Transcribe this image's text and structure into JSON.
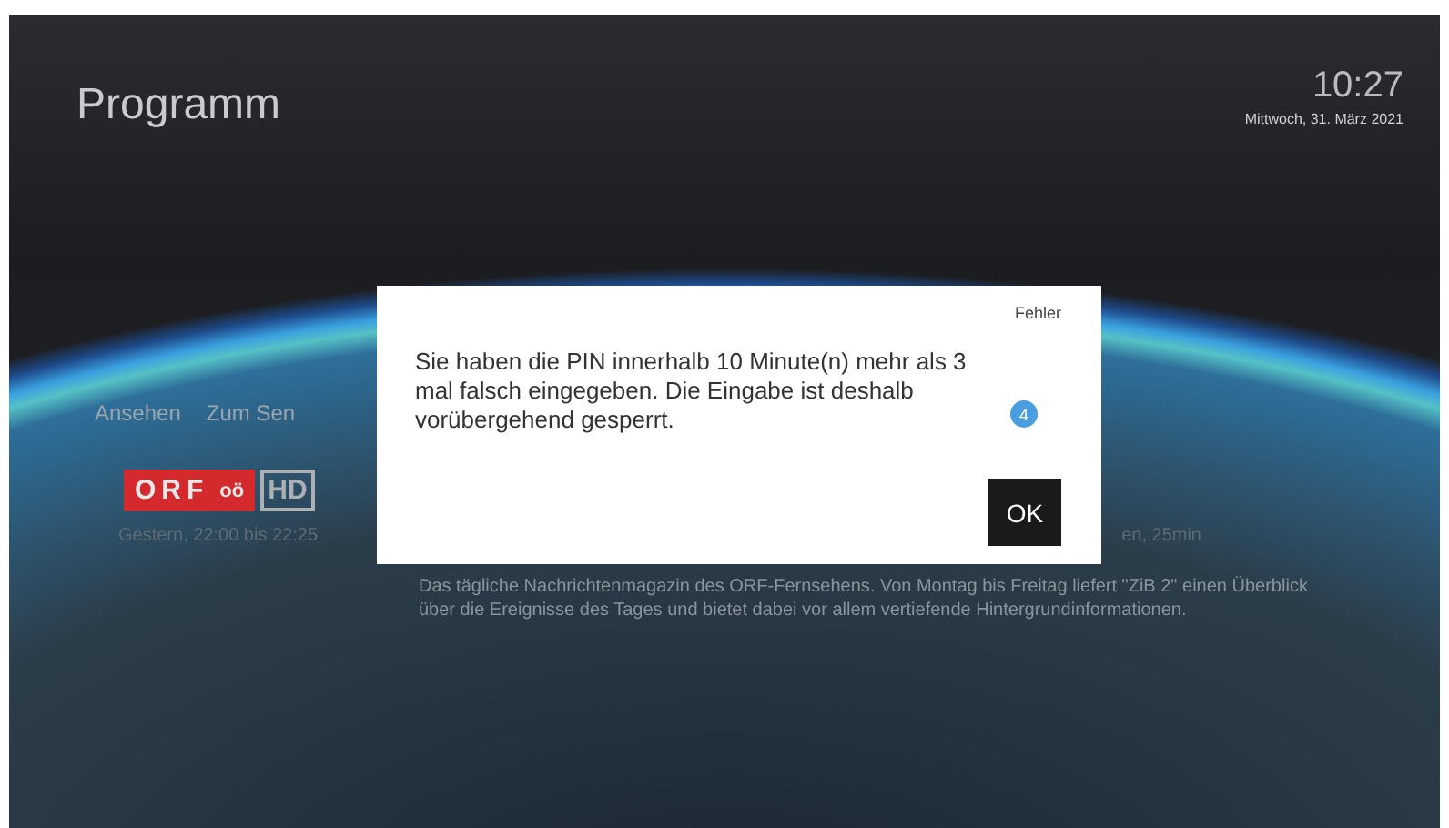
{
  "header": {
    "title": "Programm",
    "time": "10:27",
    "date": "Mittwoch, 31. März 2021"
  },
  "actions": [
    "Ansehen",
    "Zum Sen"
  ],
  "channel_logo": {
    "name": "ORF",
    "region": "oö",
    "quality": "HD"
  },
  "broadcast_time": "Gestern, 22:00 bis 22:25",
  "duration": "en, 25min",
  "description": "Das tägliche Nachrichtenmagazin des ORF-Fernsehens. Von Montag bis Freitag liefert \"ZiB 2\" einen Überblick über die Ereignisse des Tages und bietet dabei vor allem vertiefende Hintergrundinformationen.",
  "dialog": {
    "title": "Fehler",
    "message": "Sie haben die PIN innerhalb 10 Minute(n) mehr als 3 mal falsch eingegeben. Die Eingabe ist deshalb vorübergehend gesperrt.",
    "badge": "4",
    "button": "OK"
  }
}
